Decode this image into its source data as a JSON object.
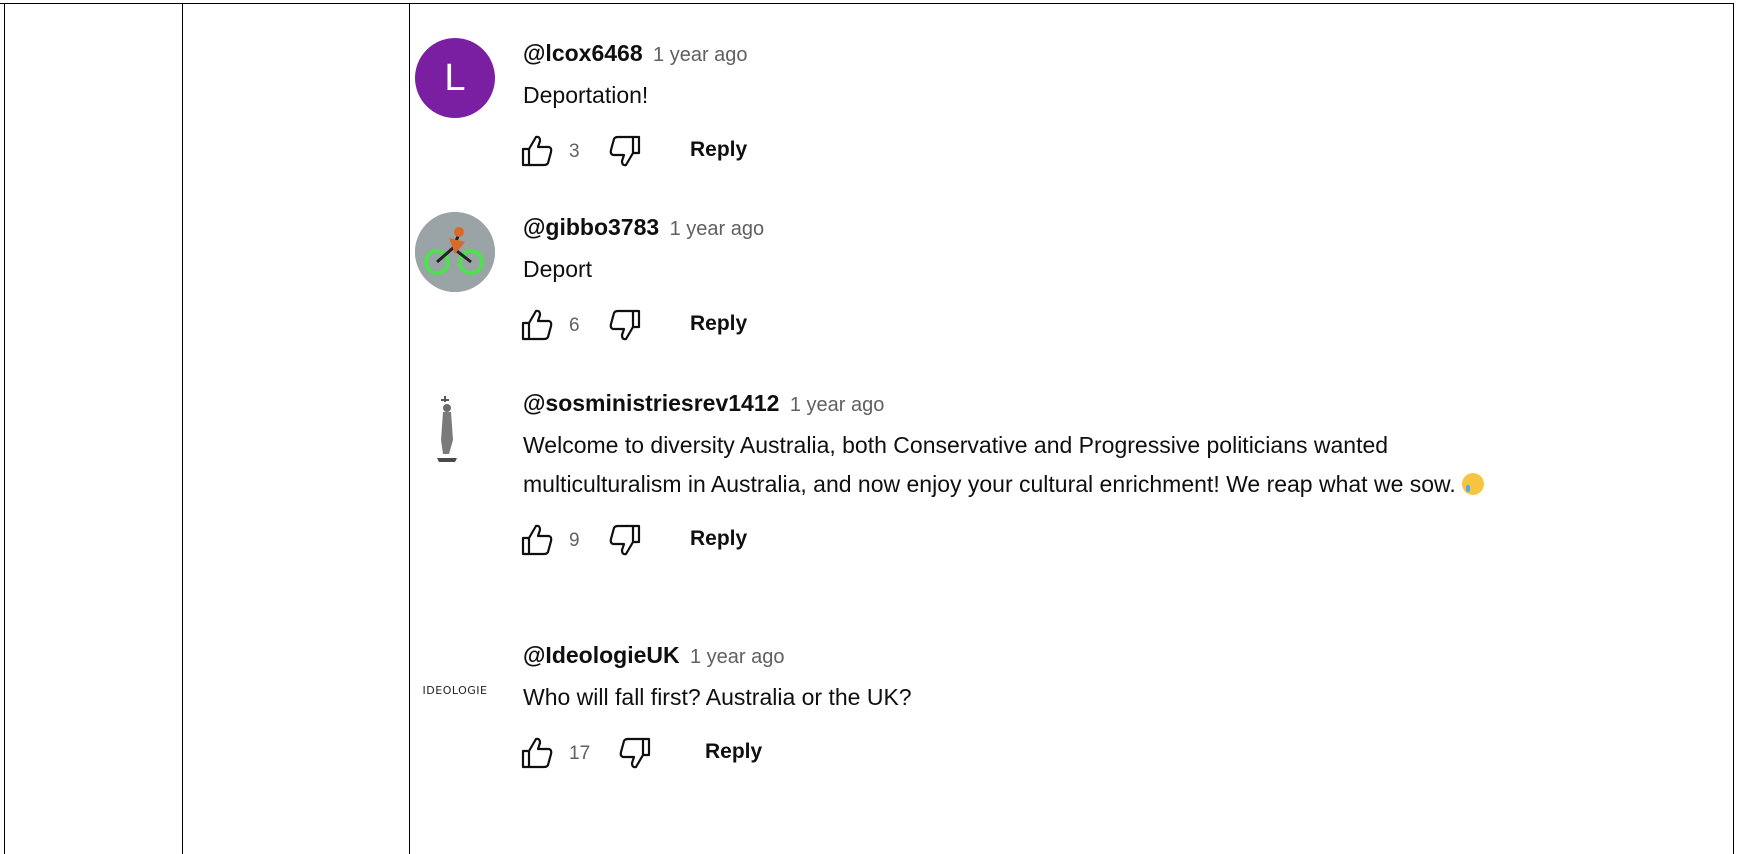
{
  "comments": [
    {
      "handle": "@lcox6468",
      "time": "1 year ago",
      "text": "Deportation!",
      "avatar_letter": "L",
      "avatar_color": "#7b1fa2",
      "likes": "3",
      "reply_label": "Reply"
    },
    {
      "handle": "@gibbo3783",
      "time": "1 year ago",
      "text": "Deport",
      "likes": "6",
      "reply_label": "Reply"
    },
    {
      "handle": "@sosministriesrev1412",
      "time": "1 year ago",
      "text": "Welcome to diversity Australia, both Conservative and Progressive politicians wanted multiculturalism in Australia, and now enjoy your cultural enrichment!  We reap what we sow.",
      "likes": "9",
      "reply_label": "Reply"
    },
    {
      "handle": "@IdeologieUK",
      "time": "1 year ago",
      "text": "Who will fall first? Australia or the UK?",
      "avatar_logo_text": "IDEOLOGIE",
      "likes": "17",
      "reply_label": "Reply"
    }
  ],
  "icons": {
    "like": "thumbs-up-outline",
    "dislike": "thumbs-down-outline",
    "emoji": "crying-face"
  }
}
